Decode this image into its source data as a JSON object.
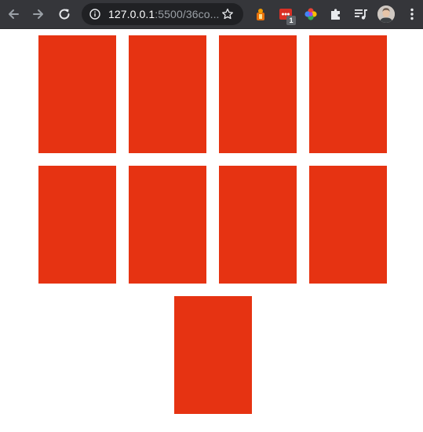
{
  "browser": {
    "url_host": "127.0.0.1",
    "url_rest": ":5500/36co...",
    "extension_badge": "1"
  },
  "icons": {
    "back": "arrow-left-icon",
    "forward": "arrow-right-icon",
    "reload": "reload-icon",
    "info": "info-icon",
    "star": "star-icon",
    "menu": "kebab-menu-icon"
  },
  "colors": {
    "card": "#e63312",
    "toolbar": "#35363a",
    "omnibox": "#202124"
  },
  "cards": [
    {},
    {},
    {},
    {},
    {},
    {},
    {},
    {},
    {}
  ]
}
